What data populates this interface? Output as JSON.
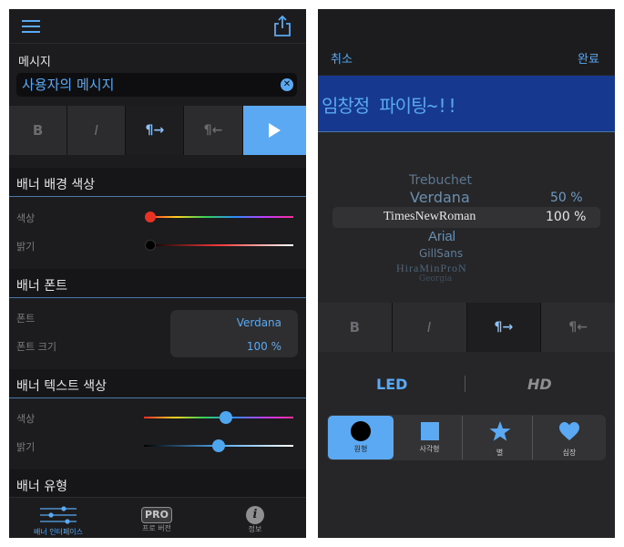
{
  "left": {
    "message": {
      "label": "메시지",
      "value": "사용자의 메시지"
    },
    "format_buttons": [
      "B",
      "I",
      "¶→",
      "¶←"
    ],
    "sections": {
      "bg_color": "배너 배경 색상",
      "font": "배너 폰트",
      "text_color": "배너 텍스트 색상",
      "type": "배너 유형"
    },
    "bg_color": {
      "color_label": "색상",
      "brightness_label": "밝기",
      "color_level": 0,
      "brightness_level": 0
    },
    "font": {
      "font_label": "폰트",
      "font_value": "Verdana",
      "size_label": "폰트 크기",
      "size_value": "100 %"
    },
    "text_color": {
      "color_label": "색상",
      "brightness_label": "밝기",
      "color_level": 0.54,
      "brightness_level": 0.5
    },
    "tabs": [
      {
        "icon": "sliders-icon",
        "label": "배너 인터페이스",
        "active": true
      },
      {
        "icon": "pro-icon",
        "badge": "PRO",
        "label": "프로 버전",
        "active": false
      },
      {
        "icon": "info-icon",
        "label": "정보",
        "active": false
      }
    ]
  },
  "right": {
    "cancel": "취소",
    "done": "완료",
    "banner_text": "임창정 파이팅~!!",
    "font_picker": [
      "Trebuchet",
      "Verdana",
      "TimesNewRoman",
      "Arial",
      "GillSans",
      "HiraMinProN",
      "Georgia"
    ],
    "size_picker": [
      "50 %",
      "100 %"
    ],
    "format_buttons": [
      "B",
      "I",
      "¶→",
      "¶←"
    ],
    "mode": {
      "led": "LED",
      "hd": "HD"
    },
    "shapes": [
      {
        "icon": "circle-icon",
        "label": "원형",
        "selected": true
      },
      {
        "icon": "square-icon",
        "label": "사각형",
        "selected": false
      },
      {
        "icon": "star-icon",
        "label": "별",
        "selected": false
      },
      {
        "icon": "heart-icon",
        "label": "심장",
        "selected": false
      }
    ],
    "colors": {
      "accent": "#5aa9f2",
      "banner_bg": "#16398f"
    }
  }
}
